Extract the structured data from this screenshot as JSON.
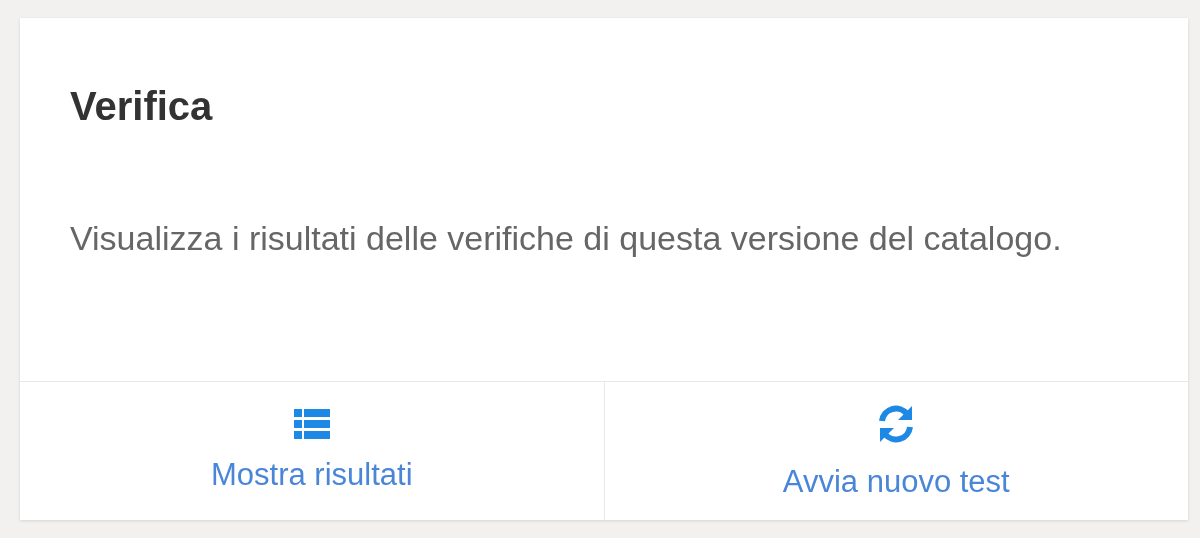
{
  "card": {
    "title": "Verifica",
    "description": "Visualizza i risultati delle verifiche di questa versione del catalogo.",
    "actions": [
      {
        "kind": "list",
        "label": "Mostra risultati"
      },
      {
        "kind": "refresh",
        "label": "Avvia nuovo test"
      }
    ]
  }
}
